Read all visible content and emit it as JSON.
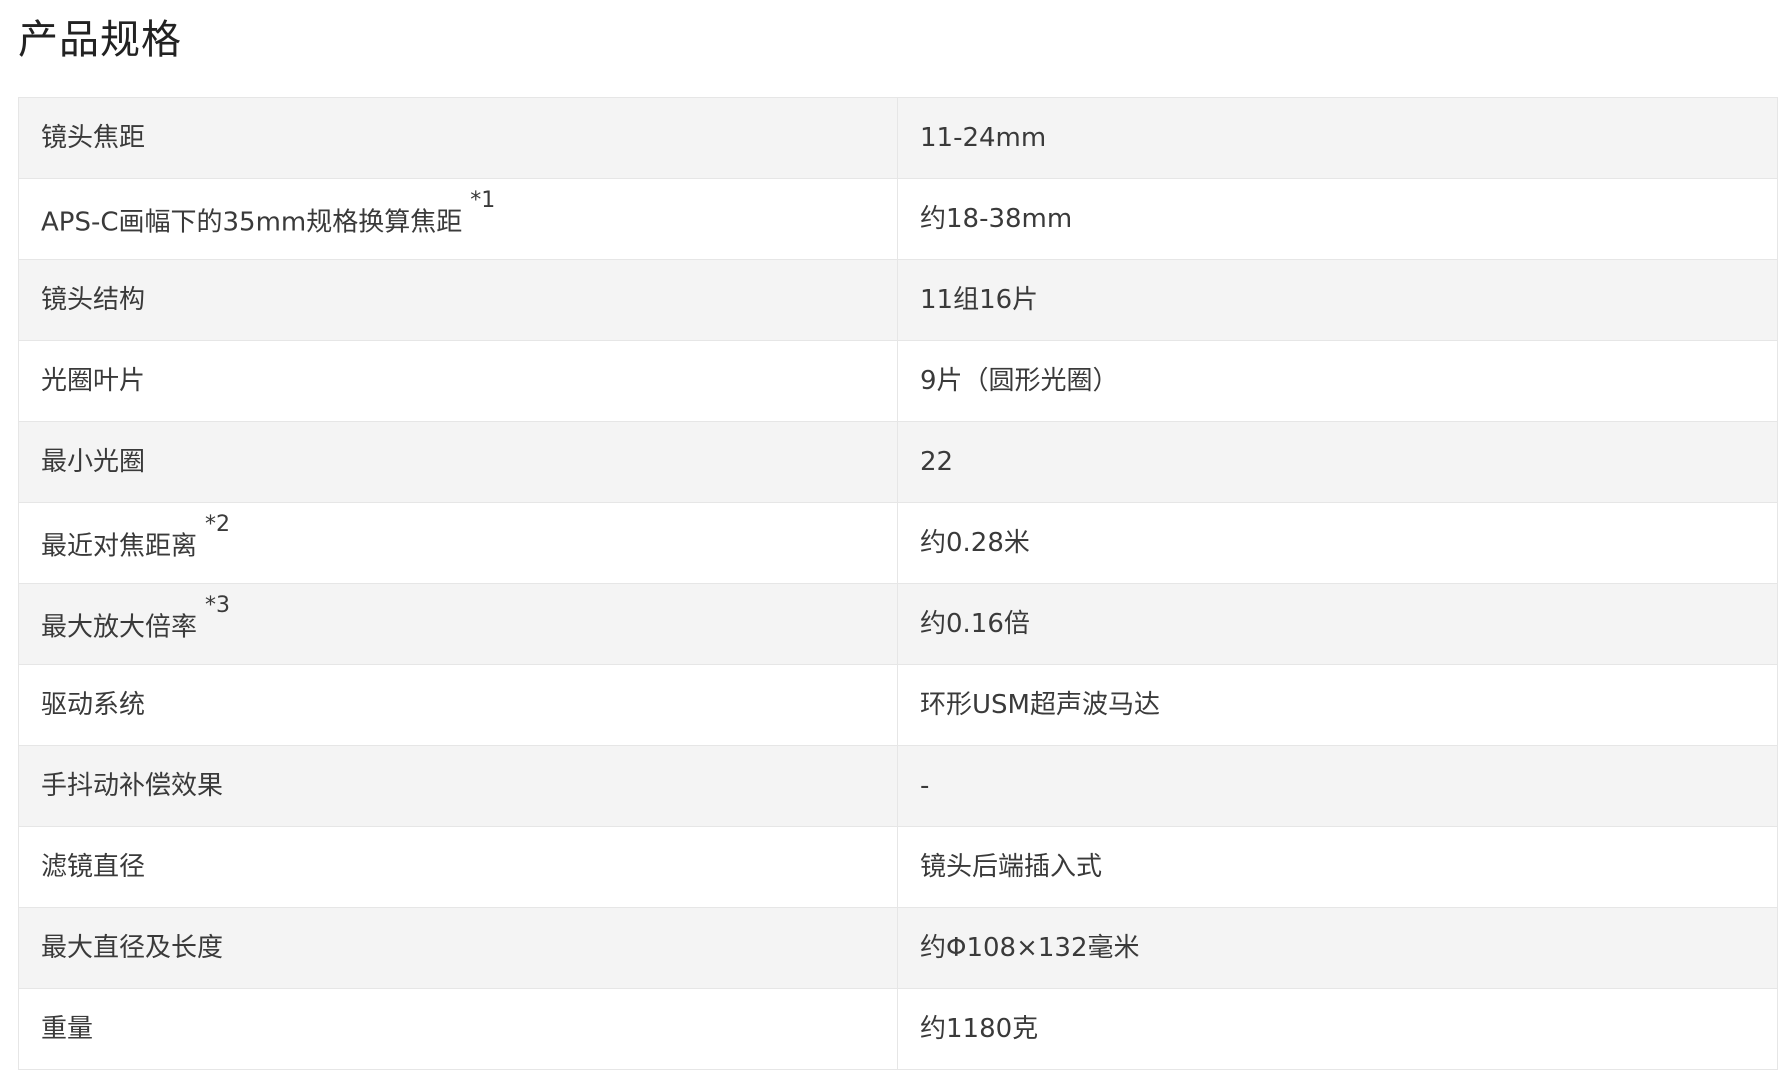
{
  "title": "产品规格",
  "specs": [
    {
      "label": "镜头焦距",
      "note": "",
      "value": "11-24mm"
    },
    {
      "label": "APS-C画幅下的35mm规格换算焦距",
      "note": "*1",
      "value": "约18-38mm"
    },
    {
      "label": "镜头结构",
      "note": "",
      "value": "11组16片"
    },
    {
      "label": "光圈叶片",
      "note": "",
      "value": "9片（圆形光圈）"
    },
    {
      "label": "最小光圈",
      "note": "",
      "value": "22"
    },
    {
      "label": "最近对焦距离",
      "note": "*2",
      "value": "约0.28米"
    },
    {
      "label": "最大放大倍率",
      "note": "*3",
      "value": "约0.16倍"
    },
    {
      "label": "驱动系统",
      "note": "",
      "value": "环形USM超声波马达"
    },
    {
      "label": "手抖动补偿效果",
      "note": "",
      "value": "-"
    },
    {
      "label": "滤镜直径",
      "note": "",
      "value": "镜头后端插入式"
    },
    {
      "label": "最大直径及长度",
      "note": "",
      "value": "约Φ108×132毫米"
    },
    {
      "label": "重量",
      "note": "",
      "value": "约1180克"
    }
  ]
}
